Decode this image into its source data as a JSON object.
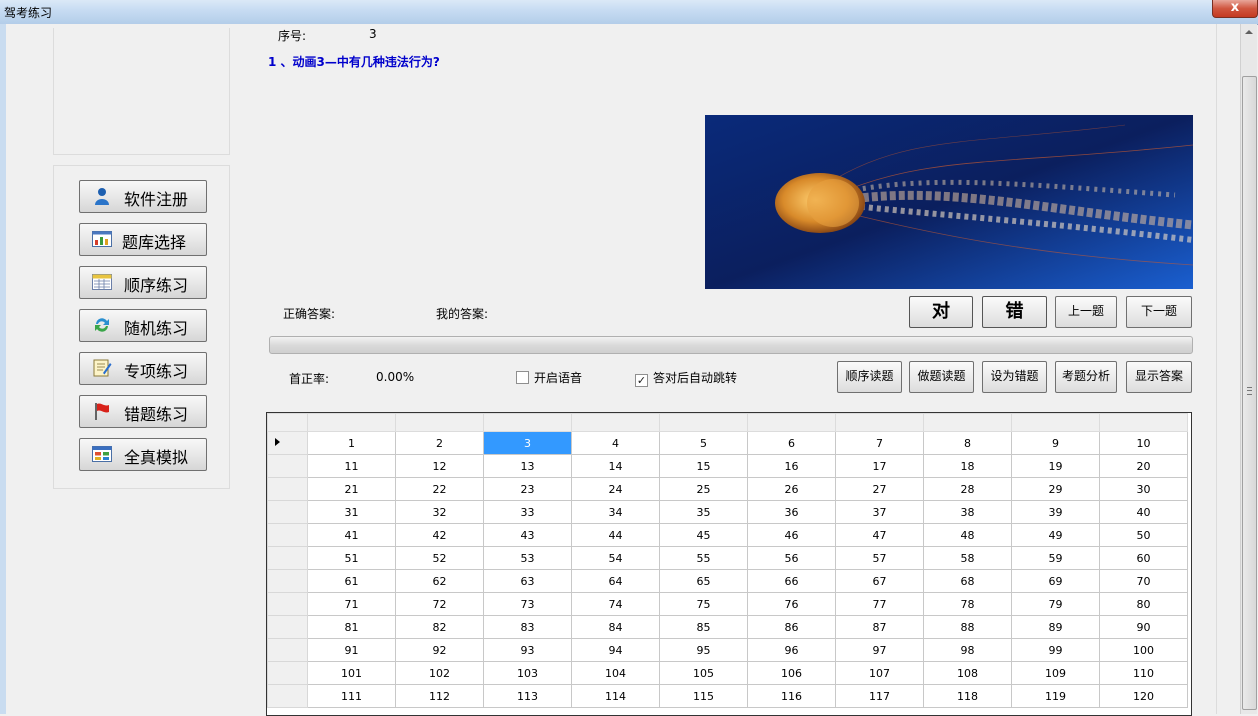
{
  "window": {
    "title": "驾考练习",
    "close_glyph": "x"
  },
  "sidebar": {
    "buttons": [
      {
        "label": "软件注册",
        "icon": "user-icon"
      },
      {
        "label": "题库选择",
        "icon": "chart-icon"
      },
      {
        "label": "顺序练习",
        "icon": "table-icon"
      },
      {
        "label": "随机练习",
        "icon": "refresh-icon"
      },
      {
        "label": "专项练习",
        "icon": "notepad-icon"
      },
      {
        "label": "错题练习",
        "icon": "flag-icon"
      },
      {
        "label": "全真模拟",
        "icon": "window-icon"
      }
    ]
  },
  "question": {
    "seq_label": "序号:",
    "seq_value": "3",
    "text": "1 、动画3—中有几种违法行为?",
    "image": "jellyfish-image"
  },
  "answers": {
    "correct_label": "正确答案:",
    "mine_label": "我的答案:"
  },
  "buttons": {
    "right": "对",
    "wrong": "错",
    "prev": "上一题",
    "next": "下一题",
    "seq_read": "顺序读题",
    "do_read": "做题读题",
    "set_wrong": "设为错题",
    "analysis": "考题分析",
    "show_answer": "显示答案"
  },
  "stats": {
    "accuracy_label": "首正率:",
    "accuracy_value": "0.00%"
  },
  "options": {
    "voice_label": "开启语音",
    "voice_checked": false,
    "autojump_label": "答对后自动跳转",
    "autojump_checked": true
  },
  "grid": {
    "selected": "3",
    "rows": [
      [
        "1",
        "2",
        "3",
        "4",
        "5",
        "6",
        "7",
        "8",
        "9",
        "10"
      ],
      [
        "11",
        "12",
        "13",
        "14",
        "15",
        "16",
        "17",
        "18",
        "19",
        "20"
      ],
      [
        "21",
        "22",
        "23",
        "24",
        "25",
        "26",
        "27",
        "28",
        "29",
        "30"
      ],
      [
        "31",
        "32",
        "33",
        "34",
        "35",
        "36",
        "37",
        "38",
        "39",
        "40"
      ],
      [
        "41",
        "42",
        "43",
        "44",
        "45",
        "46",
        "47",
        "48",
        "49",
        "50"
      ],
      [
        "51",
        "52",
        "53",
        "54",
        "55",
        "56",
        "57",
        "58",
        "59",
        "60"
      ],
      [
        "61",
        "62",
        "63",
        "64",
        "65",
        "66",
        "67",
        "68",
        "69",
        "70"
      ],
      [
        "71",
        "72",
        "73",
        "74",
        "75",
        "76",
        "77",
        "78",
        "79",
        "80"
      ],
      [
        "81",
        "82",
        "83",
        "84",
        "85",
        "86",
        "87",
        "88",
        "89",
        "90"
      ],
      [
        "91",
        "92",
        "93",
        "94",
        "95",
        "96",
        "97",
        "98",
        "99",
        "100"
      ],
      [
        "101",
        "102",
        "103",
        "104",
        "105",
        "106",
        "107",
        "108",
        "109",
        "110"
      ],
      [
        "111",
        "112",
        "113",
        "114",
        "115",
        "116",
        "117",
        "118",
        "119",
        "120"
      ]
    ]
  },
  "colors": {
    "question_text": "#0000cc",
    "selection": "#3399ff"
  }
}
